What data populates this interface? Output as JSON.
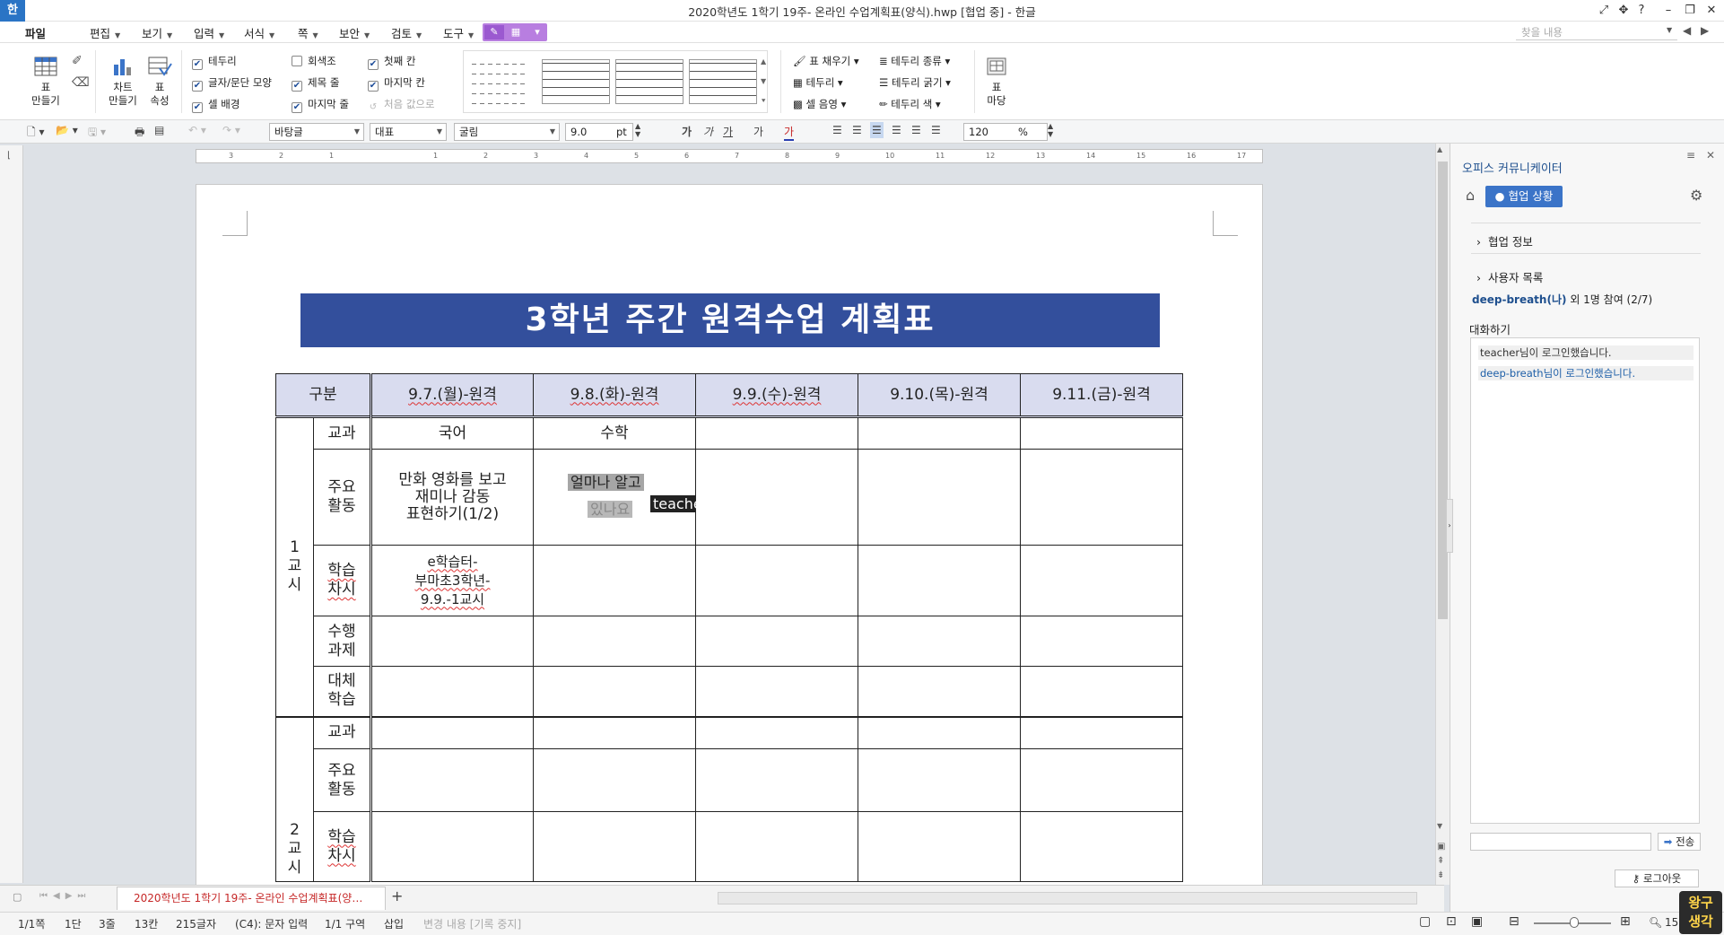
{
  "app": {
    "logo": "한",
    "title": "2020학년도 1학기 19주- 온라인 수업계획표(양식).hwp [협업 중] - 한글",
    "help": "?"
  },
  "menu": {
    "items": [
      "파일",
      "편집",
      "보기",
      "입력",
      "서식",
      "쪽",
      "보안",
      "검토",
      "도구"
    ],
    "search_placeholder": "찾을 내용"
  },
  "ribbon": {
    "table_make": "표\n만들기",
    "chart_make": "차트\n만들기",
    "table_props": "표\n속성",
    "checks": [
      {
        "label": "테두리",
        "checked": true
      },
      {
        "label": "글자/문단 모양",
        "checked": true
      },
      {
        "label": "셀 배경",
        "checked": true
      },
      {
        "label": "회색조",
        "checked": false
      },
      {
        "label": "제목 줄",
        "checked": true
      },
      {
        "label": "마지막 줄",
        "checked": true
      },
      {
        "label": "첫째 칸",
        "checked": true
      },
      {
        "label": "마지막 칸",
        "checked": true
      },
      {
        "label": "처음 값으로",
        "checked": false,
        "disabled": true
      }
    ],
    "fill": "표 채우기",
    "border": "테두리",
    "cell_shade": "셀 음영",
    "border_type": "테두리 종류",
    "border_width": "테두리 굵기",
    "border_color": "테두리 색",
    "table_madang": "표\n마당"
  },
  "format": {
    "style": "바탕글",
    "lang": "대표",
    "font": "굴림",
    "size": "9.0",
    "size_unit": "pt",
    "bold": "가",
    "italic": "가",
    "underline": "가",
    "strike": "가",
    "font_color": "가",
    "zoom": "120",
    "zoom_unit": "%"
  },
  "ruler": {
    "ticks": [
      "3",
      "2",
      "1",
      "1",
      "2",
      "3",
      "4",
      "5",
      "6",
      "7",
      "8",
      "9",
      "10",
      "11",
      "12",
      "13",
      "14",
      "15",
      "16",
      "17"
    ]
  },
  "document": {
    "title": "3학년 주간 원격수업 계획표",
    "header": [
      "구분",
      "9.7.(월)-원격",
      "9.8.(화)-원격",
      "9.9.(수)-원격",
      "9.10.(목)-원격",
      "9.11.(금)-원격"
    ],
    "periods": [
      {
        "label": "1\n교\n시",
        "rows": [
          {
            "name": "교과",
            "cells": [
              "국어",
              "수학",
              "",
              "",
              ""
            ]
          },
          {
            "name": "주요\n활동",
            "cells": [
              "만화 영화를 보고\n재미나 감동\n표현하기(1/2)",
              "",
              "",
              "",
              ""
            ]
          },
          {
            "name": "학습\n차시",
            "cells": [
              "e학습터-\n부마초3학년-\n9.9.-1교시",
              "",
              "",
              "",
              ""
            ]
          },
          {
            "name": "수행\n과제",
            "cells": [
              "",
              "",
              "",
              "",
              ""
            ]
          },
          {
            "name": "대체\n학습",
            "cells": [
              "",
              "",
              "",
              "",
              ""
            ]
          }
        ]
      },
      {
        "label": "2\n교\n시",
        "rows": [
          {
            "name": "교과",
            "cells": [
              "",
              "",
              "",
              "",
              ""
            ]
          },
          {
            "name": "주요\n활동",
            "cells": [
              "",
              "",
              "",
              "",
              ""
            ]
          },
          {
            "name": "학습\n차시",
            "cells": [
              "",
              "",
              "",
              "",
              ""
            ]
          }
        ]
      }
    ],
    "collab_text_1": "얼마나 알고",
    "collab_text_2": "있나요",
    "collab_cursor": "teache"
  },
  "tabs": {
    "doc_tab": "2020학년도 1학기 19주- 온라인 수업계획표(양…",
    "add": "+"
  },
  "status": {
    "page": "1/1쪽",
    "section": "1단",
    "line": "3줄",
    "col": "13칸",
    "chars": "215글자",
    "mode": "(C4): 문자 입력",
    "area": "1/1 구역",
    "insert": "삽입",
    "track": "변경 내용 [기록 중지]",
    "zoom_text": "15"
  },
  "panel": {
    "title": "오피스 커뮤니케이터",
    "status_button": "협업 상황",
    "collab_info": "협업 정보",
    "user_list": "사용자 목록",
    "user_name": "deep-breath(나)",
    "user_count": "외 1명 참여 (2/7)",
    "chat_title": "대화하기",
    "messages": [
      "teacher님이 로그인했습니다.",
      "deep-breath님이 로그인했습니다."
    ],
    "send": "전송",
    "logout": "로그아웃"
  },
  "corner_logo": "왕구\n생각",
  "colors": {
    "accent": "#3b74c8",
    "title_bar": "#334f9c",
    "header_fill": "#d9dcef",
    "tab_text": "#c62828"
  }
}
